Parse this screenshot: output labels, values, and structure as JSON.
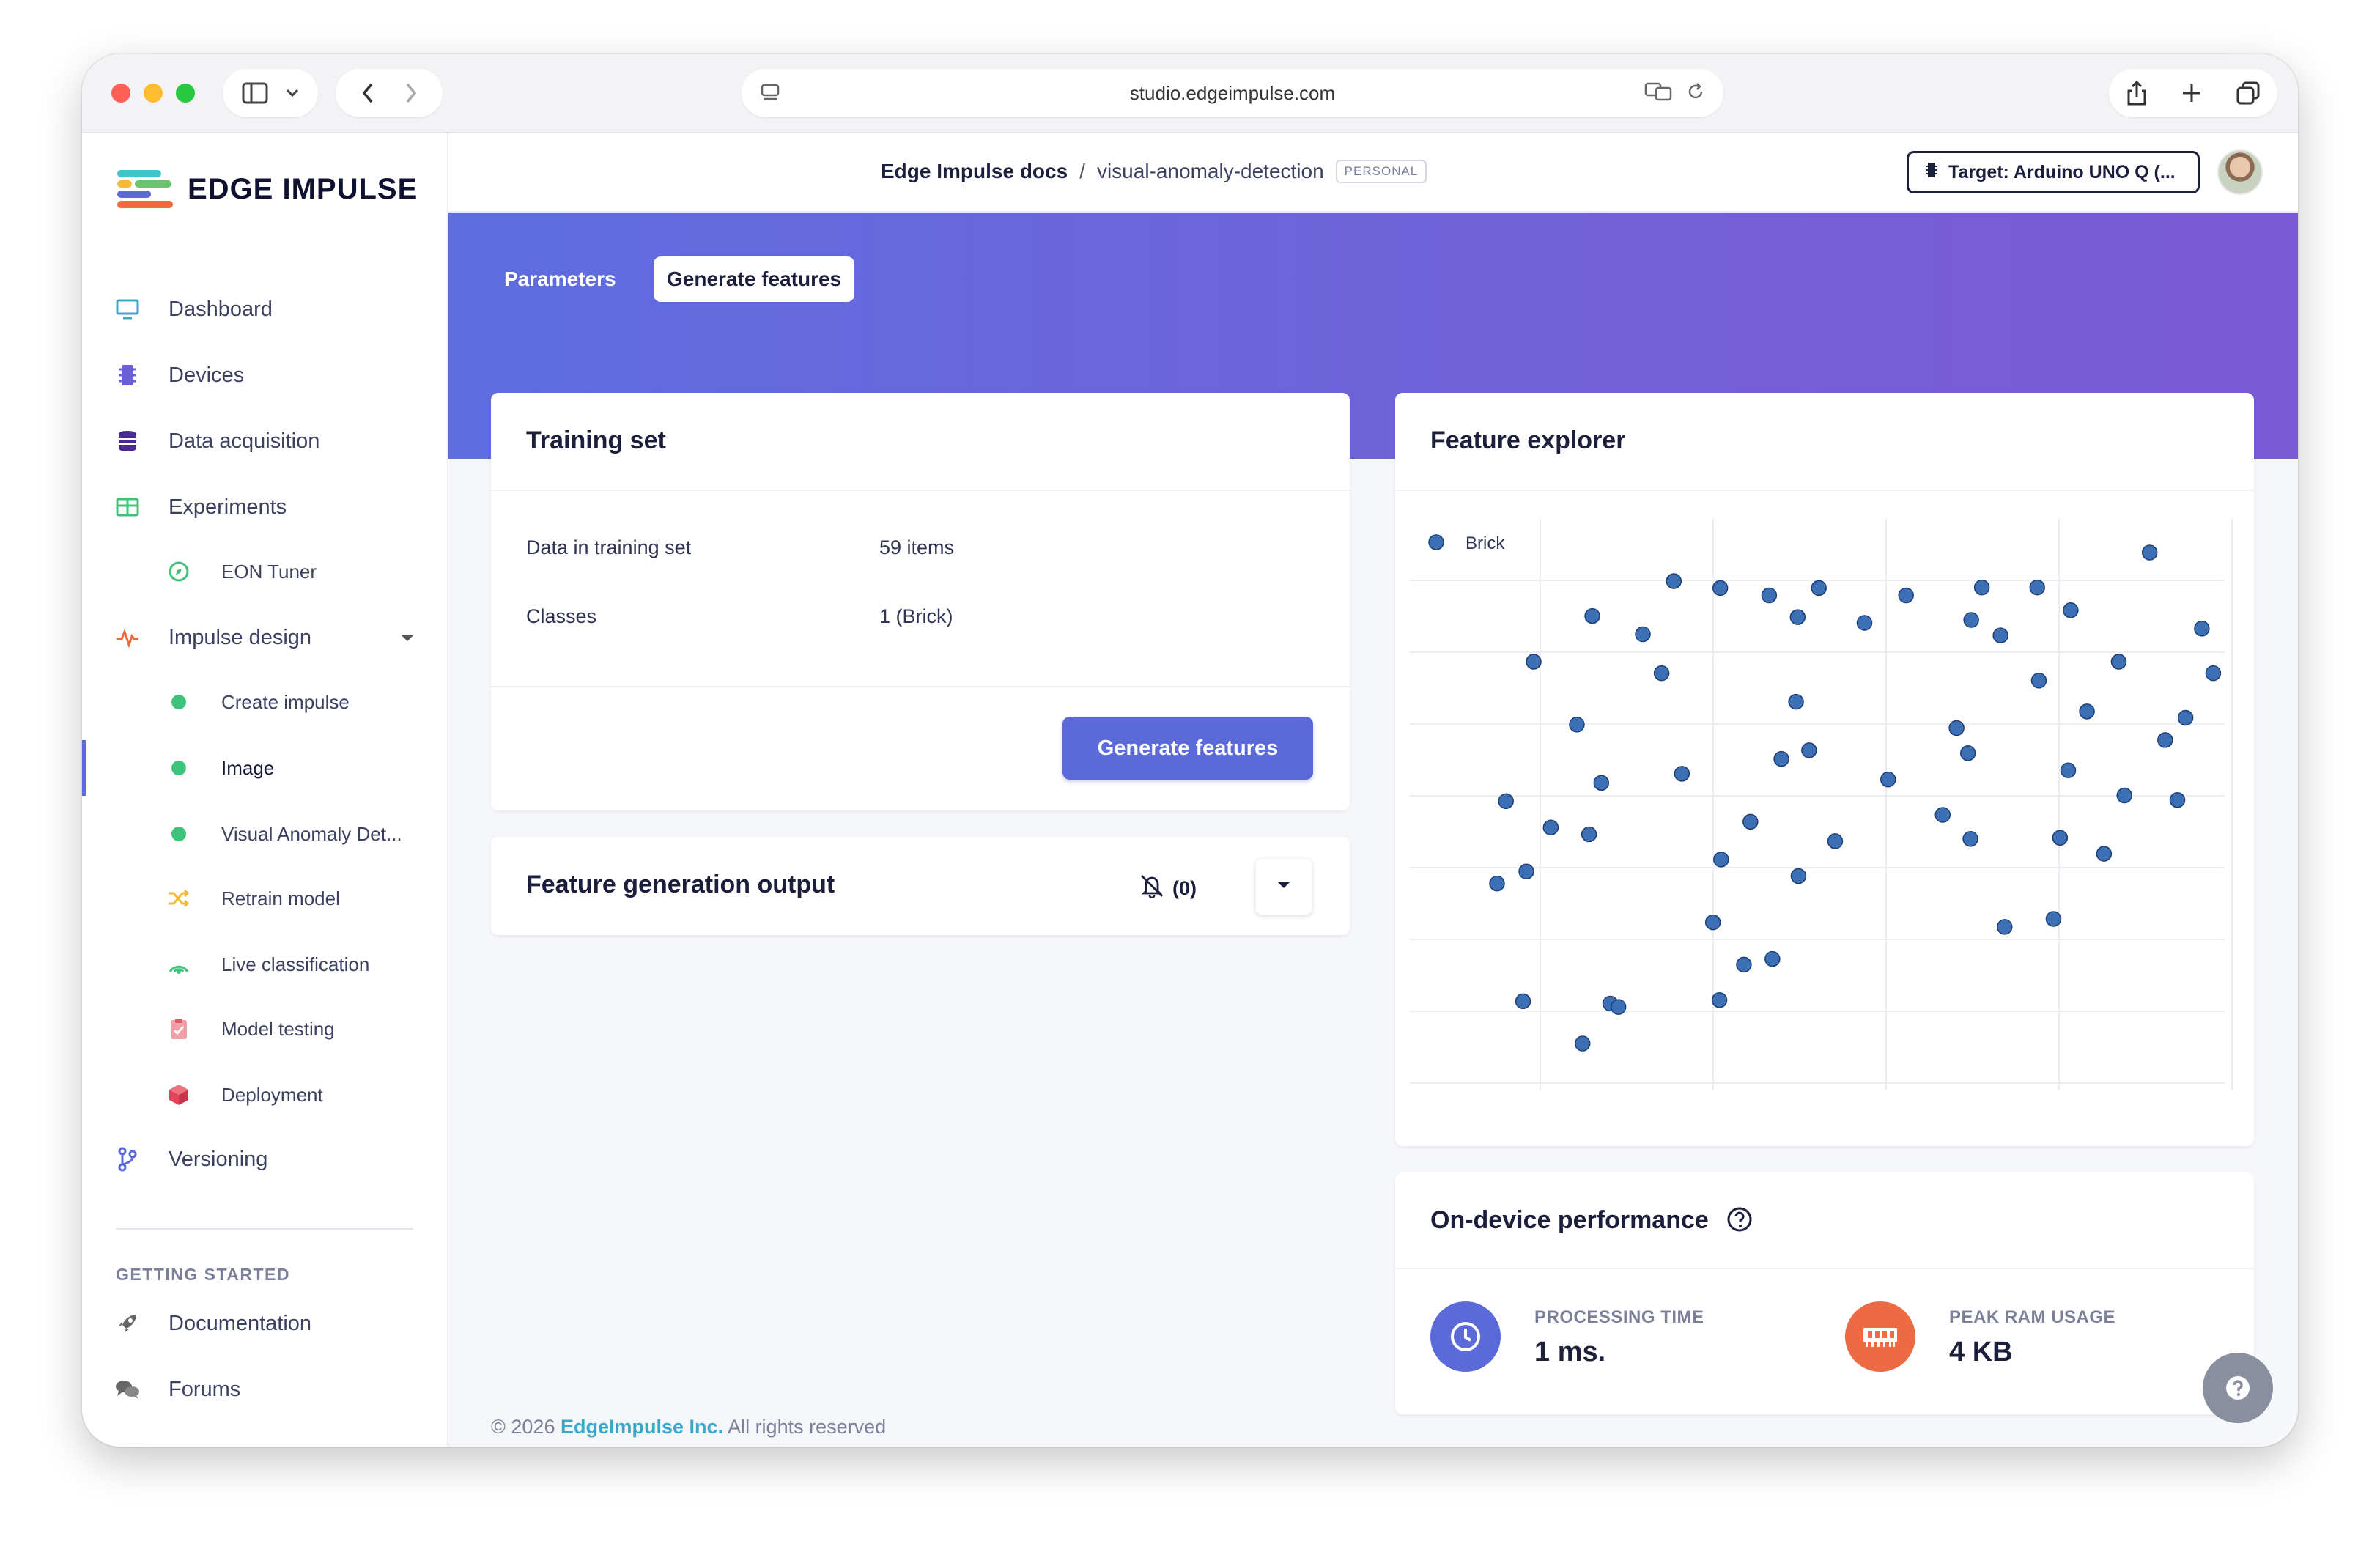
{
  "browser": {
    "url": "studio.edgeimpulse.com"
  },
  "app": {
    "logo_text": "EDGE IMPULSE"
  },
  "sidebar": {
    "items": [
      {
        "label": "Dashboard"
      },
      {
        "label": "Devices"
      },
      {
        "label": "Data acquisition"
      },
      {
        "label": "Experiments"
      },
      {
        "label": "EON Tuner"
      },
      {
        "label": "Impulse design"
      },
      {
        "label": "Create impulse"
      },
      {
        "label": "Image"
      },
      {
        "label": "Visual Anomaly Det..."
      },
      {
        "label": "Retrain model"
      },
      {
        "label": "Live classification"
      },
      {
        "label": "Model testing"
      },
      {
        "label": "Deployment"
      },
      {
        "label": "Versioning"
      }
    ],
    "section_getting_started": "GETTING STARTED",
    "getting_started": [
      {
        "label": "Documentation"
      },
      {
        "label": "Forums"
      }
    ]
  },
  "header": {
    "org": "Edge Impulse docs",
    "separator": "/",
    "project": "visual-anomaly-detection",
    "badge": "PERSONAL",
    "target": "Target: Arduino UNO Q (..."
  },
  "tabs": {
    "parameters": "Parameters",
    "generate_features": "Generate features"
  },
  "training_set": {
    "title": "Training set",
    "rows": [
      {
        "key": "Data in training set",
        "value": "59 items"
      },
      {
        "key": "Classes",
        "value": "1 (Brick)"
      }
    ],
    "button": "Generate features"
  },
  "output": {
    "title": "Feature generation output",
    "count": "(0)"
  },
  "feature_explorer": {
    "title": "Feature explorer"
  },
  "chart_data": {
    "type": "scatter",
    "title": "",
    "xlabel": "",
    "ylabel": "",
    "grid": true,
    "legend_placement": "top-left",
    "xlim": [
      0,
      100
    ],
    "ylim": [
      0,
      100
    ],
    "series": [
      {
        "name": "Brick",
        "color": "#3d6fb5",
        "points": [
          [
            90.8,
            94.1
          ],
          [
            70.2,
            88.0
          ],
          [
            77.0,
            88.0
          ],
          [
            81.1,
            84.0
          ],
          [
            60.9,
            86.6
          ],
          [
            68.9,
            82.3
          ],
          [
            72.5,
            79.6
          ],
          [
            87.0,
            75.0
          ],
          [
            77.2,
            71.7
          ],
          [
            83.1,
            66.3
          ],
          [
            67.1,
            63.4
          ],
          [
            92.7,
            61.3
          ],
          [
            68.5,
            59.0
          ],
          [
            80.8,
            56.0
          ],
          [
            97.2,
            80.8
          ],
          [
            98.6,
            73.0
          ],
          [
            95.2,
            65.2
          ],
          [
            94.2,
            50.8
          ],
          [
            87.7,
            51.6
          ],
          [
            79.8,
            44.2
          ],
          [
            65.4,
            48.2
          ],
          [
            68.8,
            44.0
          ],
          [
            85.2,
            41.4
          ],
          [
            73.0,
            28.6
          ],
          [
            79.0,
            30.0
          ],
          [
            32.4,
            89.1
          ],
          [
            50.2,
            87.9
          ],
          [
            38.1,
            87.9
          ],
          [
            44.1,
            86.6
          ],
          [
            22.4,
            83.0
          ],
          [
            47.6,
            82.8
          ],
          [
            55.8,
            81.8
          ],
          [
            28.6,
            79.8
          ],
          [
            15.2,
            75.0
          ],
          [
            30.9,
            73.0
          ],
          [
            47.4,
            68.0
          ],
          [
            20.5,
            64.0
          ],
          [
            49.0,
            59.5
          ],
          [
            45.6,
            58.0
          ],
          [
            58.7,
            54.4
          ],
          [
            33.4,
            55.4
          ],
          [
            23.5,
            53.8
          ],
          [
            11.8,
            50.6
          ],
          [
            17.3,
            46.0
          ],
          [
            41.8,
            47.0
          ],
          [
            22.0,
            44.8
          ],
          [
            38.2,
            40.4
          ],
          [
            52.2,
            43.6
          ],
          [
            47.7,
            37.5
          ],
          [
            14.3,
            38.3
          ],
          [
            10.7,
            36.2
          ],
          [
            37.2,
            29.4
          ],
          [
            44.5,
            23.0
          ],
          [
            41.0,
            22.0
          ],
          [
            38.0,
            15.8
          ],
          [
            13.9,
            15.6
          ],
          [
            24.6,
            15.2
          ],
          [
            25.6,
            14.6
          ],
          [
            21.2,
            8.2
          ]
        ]
      }
    ]
  },
  "performance": {
    "title": "On-device performance",
    "processing_label": "PROCESSING TIME",
    "processing_value": "1 ms.",
    "ram_label": "PEAK RAM USAGE",
    "ram_value": "4 KB",
    "processing_color": "#5c6ad9",
    "ram_color": "#ee6a43"
  },
  "footer": {
    "copyright": "© 2026",
    "company": "EdgeImpulse Inc.",
    "rights": "All rights reserved"
  }
}
